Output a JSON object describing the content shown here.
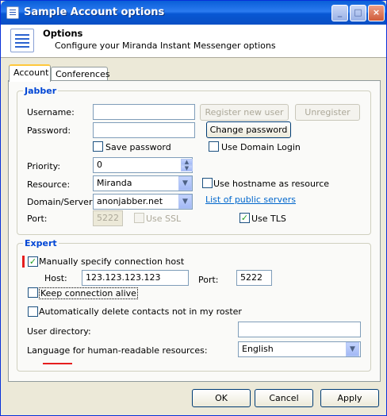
{
  "window": {
    "title": "Sample Account options",
    "controls": [
      "_",
      "□",
      "×"
    ]
  },
  "header": {
    "title": "Options",
    "subtitle": "Configure your Miranda Instant Messenger options"
  },
  "tabs": [
    {
      "label": "Account",
      "active": true
    },
    {
      "label": "Conferences",
      "active": false
    }
  ],
  "jabber": {
    "group_label": "Jabber",
    "username_label": "Username:",
    "username_value": "",
    "password_label": "Password:",
    "password_value": "",
    "register_new_user_label": "Register new user",
    "unregister_label": "Unregister",
    "change_password_label": "Change password",
    "save_password_label": "Save password",
    "use_domain_login_label": "Use Domain Login",
    "priority_label": "Priority:",
    "priority_value": "0",
    "resource_label": "Resource:",
    "resource_value": "Miranda",
    "use_hostname_label": "Use hostname as resource",
    "domain_server_label": "Domain/Server:",
    "domain_server_value": "anonjabber.net",
    "public_servers_link": "List of public servers",
    "port_label": "Port:",
    "port_value": "5222",
    "use_ssl_label": "Use SSL",
    "use_tls_label": "Use TLS",
    "use_tls_checked": true
  },
  "expert": {
    "group_label": "Expert",
    "manual_host_label": "Manually specify connection host",
    "manual_host_checked": true,
    "host_label": "Host:",
    "host_value": "123.123.123.123",
    "port_label": "Port:",
    "port_value": "5222",
    "keep_alive_label": "Keep connection alive",
    "auto_delete_label": "Automatically delete contacts not in my roster",
    "user_directory_label": "User directory:",
    "user_directory_value": "",
    "language_label": "Language for human-readable resources:",
    "language_value": "English"
  },
  "footer": {
    "ok_label": "OK",
    "cancel_label": "Cancel",
    "apply_label": "Apply"
  },
  "colors": {
    "accent": "#0046d5",
    "link": "#0066cc",
    "highlight": "#e61e1e"
  }
}
